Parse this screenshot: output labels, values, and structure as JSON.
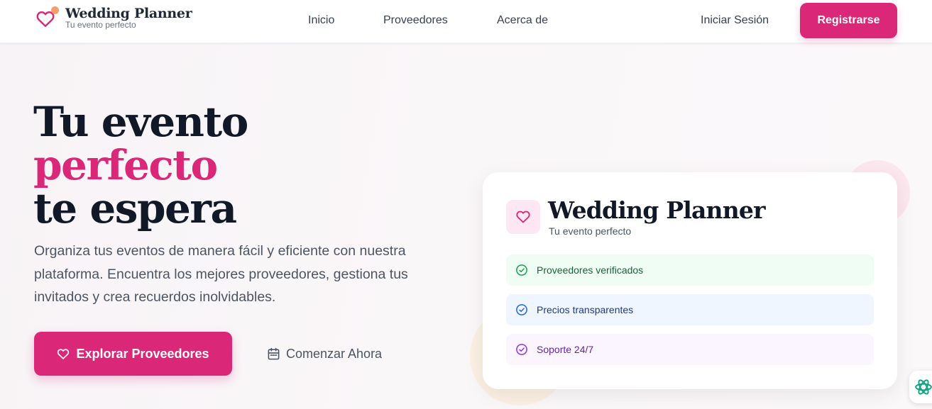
{
  "header": {
    "logo_title": "Wedding Planner",
    "logo_subtitle": "Tu evento perfecto",
    "nav": [
      "Inicio",
      "Proveedores",
      "Acerca de"
    ],
    "login_label": "Iniciar Sesión",
    "register_label": "Registrarse"
  },
  "hero": {
    "title_line1": "Tu evento",
    "title_line2": "perfecto",
    "title_line3": "te espera",
    "description": "Organiza tus eventos de manera fácil y eficiente con nuestra plataforma. Encuentra los mejores proveedores, gestiona tus invitados y crea recuerdos inolvidables.",
    "primary_button": "Explorar Proveedores",
    "secondary_button": "Comenzar Ahora"
  },
  "card": {
    "title": "Wedding Planner",
    "subtitle": "Tu evento perfecto",
    "features": [
      "Proveedores verificados",
      "Precios transparentes",
      "Soporte 24/7"
    ]
  },
  "icons": {
    "logo": "heart-icon",
    "primary_button": "heart-icon",
    "secondary_button": "calendar-icon",
    "features": "check-circle-icon",
    "widget": "atom-icon"
  },
  "colors": {
    "brand": "#db2777",
    "feature_green": "#166534",
    "feature_blue": "#1e3a8a",
    "feature_purple": "#6b21a8"
  }
}
